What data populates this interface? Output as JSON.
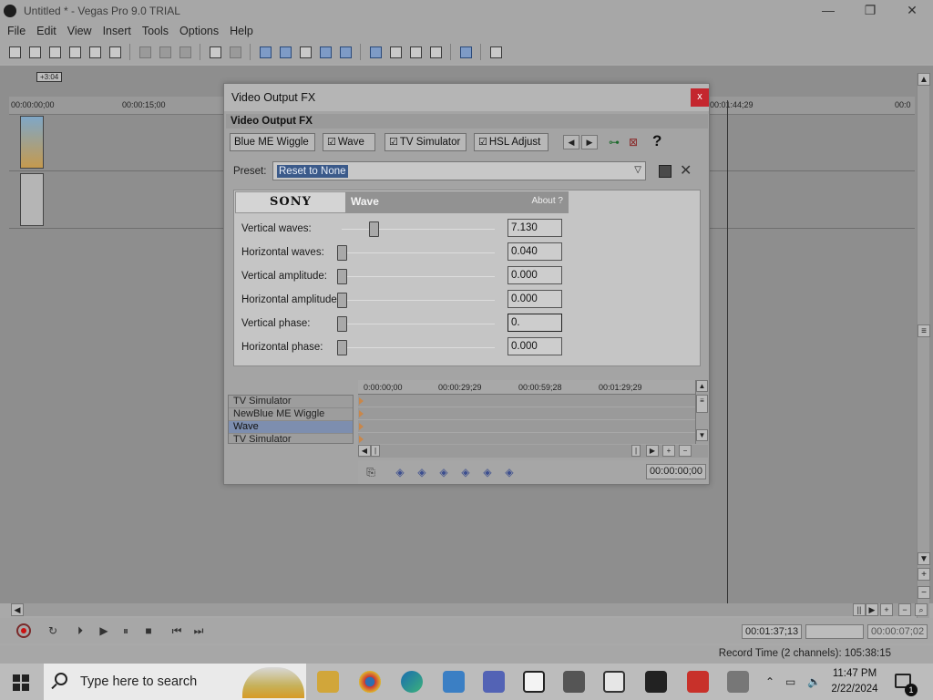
{
  "window": {
    "title": "Untitled * - Vegas Pro 9.0 TRIAL",
    "minimize": "—",
    "restore": "❐",
    "close": "✕"
  },
  "menu": [
    "File",
    "Edit",
    "View",
    "Insert",
    "Tools",
    "Options",
    "Help"
  ],
  "timeline": {
    "marker_label": "+3:04",
    "ruler_ticks": [
      "00:00:00;00",
      "00:00:15;00",
      "00:01:44;29",
      "00:0"
    ],
    "partial_tick": "29"
  },
  "transport": {
    "cursor_time": "00:01:37;13",
    "selection_length": "00:00:07;02",
    "record_time": "Record Time (2 channels): 105:38:15"
  },
  "dialog": {
    "title": "Video Output FX",
    "close_glyph": "x",
    "fx_header": "Video Output FX",
    "chain": [
      {
        "label": "Blue ME Wiggle",
        "checked": false
      },
      {
        "label": "Wave",
        "checked": true
      },
      {
        "label": "TV Simulator",
        "checked": true
      },
      {
        "label": "HSL Adjust",
        "checked": true
      }
    ],
    "help_glyph": "?",
    "preset_label": "Preset:",
    "preset_value": "Reset to None",
    "plugin": {
      "brand": "SONY",
      "name": "Wave",
      "about": "About  ?"
    },
    "params": [
      {
        "label": "Vertical waves:",
        "value": "7.130",
        "level": 0.21
      },
      {
        "label": "Horizontal waves:",
        "value": "0.040",
        "level": 0.0
      },
      {
        "label": "Vertical amplitude:",
        "value": "0.000",
        "level": 0.0
      },
      {
        "label": "Horizontal amplitude:",
        "value": "0.000",
        "level": 0.0
      },
      {
        "label": "Vertical phase:",
        "value": "0.",
        "level": 0.0
      },
      {
        "label": "Horizontal phase:",
        "value": "0.000",
        "level": 0.0
      }
    ],
    "fx_list": [
      "TV Simulator",
      "NewBlue ME Wiggle",
      "Wave",
      "TV Simulator"
    ],
    "fx_list_active": 2,
    "kf_ruler": [
      "0:00:00;00",
      "00:00:29;29",
      "00:00:59;28",
      "00:01:29;29"
    ],
    "kf_time": "00:00:00;00"
  },
  "taskbar": {
    "search_placeholder": "Type here to search",
    "time": "11:47 PM",
    "date": "2/22/2024",
    "notification_count": "1"
  }
}
